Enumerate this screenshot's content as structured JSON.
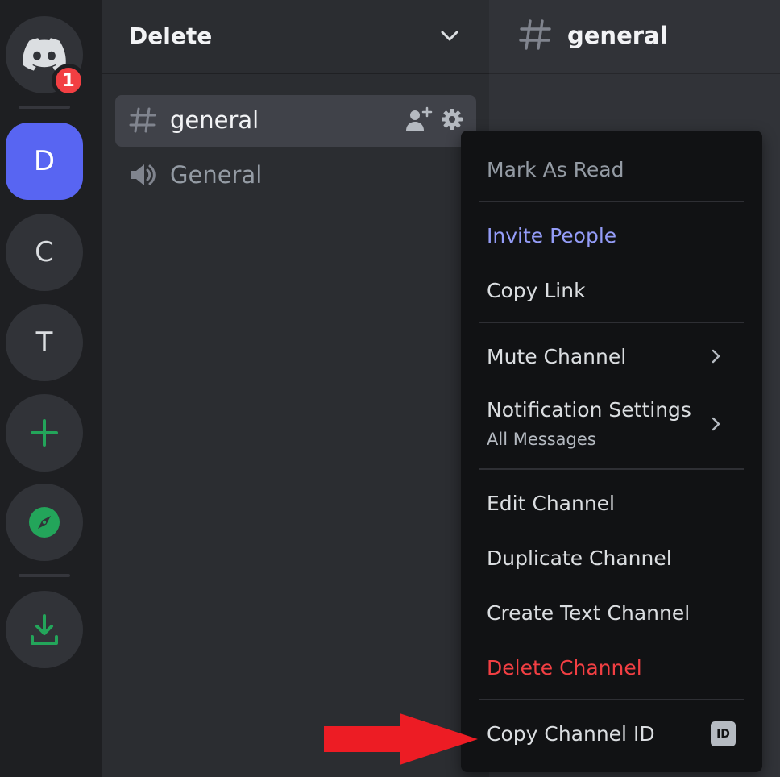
{
  "server_rail": {
    "notification_count": "1",
    "servers": [
      {
        "initial": "D",
        "active": true
      },
      {
        "initial": "C",
        "active": false
      },
      {
        "initial": "T",
        "active": false
      }
    ]
  },
  "sidebar": {
    "server_name": "Delete",
    "channels": [
      {
        "name": "general",
        "type": "text",
        "selected": true
      },
      {
        "name": "General",
        "type": "voice",
        "selected": false
      }
    ]
  },
  "main_header": {
    "channel_name": "general"
  },
  "context_menu": {
    "mark_as_read": "Mark As Read",
    "invite_people": "Invite People",
    "copy_link": "Copy Link",
    "mute_channel": "Mute Channel",
    "notification_settings": "Notification Settings",
    "notification_settings_value": "All Messages",
    "edit_channel": "Edit Channel",
    "duplicate_channel": "Duplicate Channel",
    "create_text_channel": "Create Text Channel",
    "delete_channel": "Delete Channel",
    "copy_channel_id": "Copy Channel ID",
    "id_badge": "ID"
  },
  "colors": {
    "brand": "#5865f2",
    "danger": "#f23f43",
    "green": "#23a55a",
    "annotation_arrow": "#ed1c24"
  }
}
